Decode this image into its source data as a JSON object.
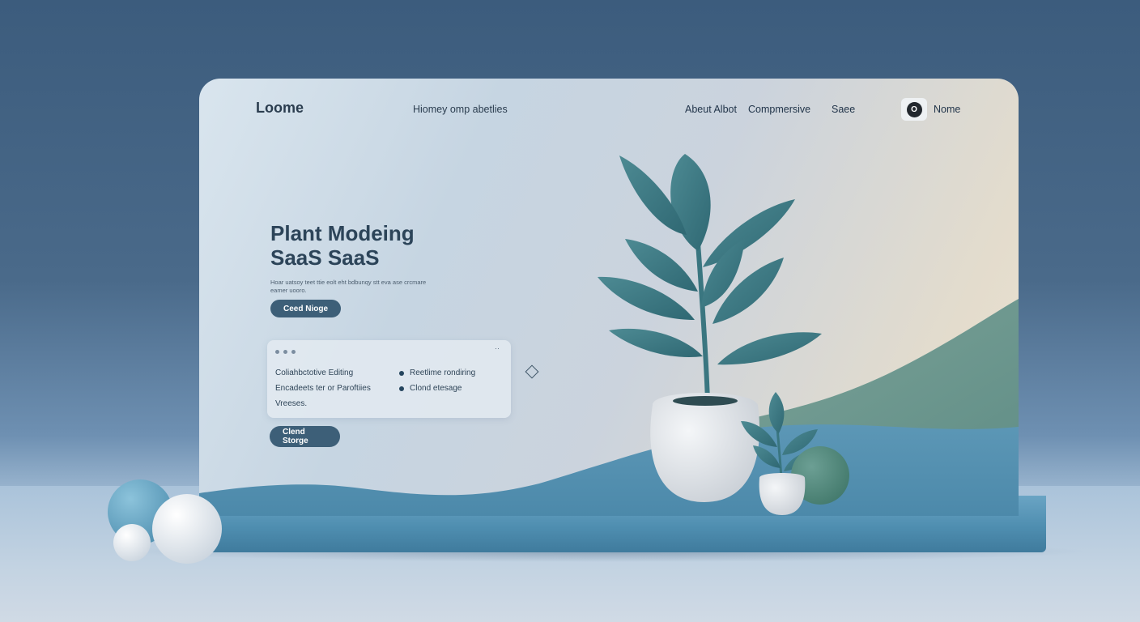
{
  "brand": {
    "logo": "Loome",
    "tagline": "Hiomey omp abetlies"
  },
  "nav": {
    "links": [
      "Abeut Albot",
      "Compmersive",
      "Saee"
    ],
    "user_initial": "O",
    "user_name": "Nome"
  },
  "hero": {
    "title_line1": "Plant Modeing",
    "title_line2": "SaaS SaaS",
    "description": "Hoar uatsoy teet  ttie eolt eht bdbunqy stt eva ase crcmare eamer uooro.",
    "cta_label": "Ceed Nioge"
  },
  "features_card": {
    "more": "··",
    "left": [
      "Coliahbctotive Editing",
      "Encadeets ter or Paroftiies",
      "Vreeses."
    ],
    "right": [
      "Reetlime rondiring",
      "Clond etesage"
    ]
  },
  "secondary_cta": {
    "label": "Clend Storge"
  },
  "colors": {
    "accent": "#3d5f78",
    "text_dark": "#2c4459",
    "plant_green": "#3e7a84",
    "pot_white": "#e8ecef"
  }
}
